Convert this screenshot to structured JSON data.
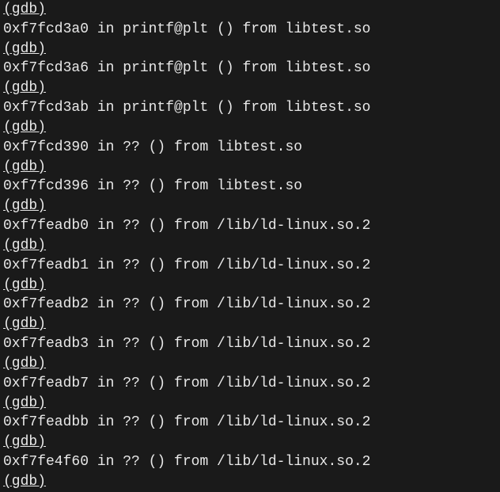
{
  "terminal": {
    "lines": [
      {
        "text": "(gdb)",
        "underline": true
      },
      {
        "text": "0xf7fcd3a0 in printf@plt () from libtest.so",
        "underline": false
      },
      {
        "text": "(gdb)",
        "underline": true
      },
      {
        "text": "0xf7fcd3a6 in printf@plt () from libtest.so",
        "underline": false
      },
      {
        "text": "(gdb)",
        "underline": true
      },
      {
        "text": "0xf7fcd3ab in printf@plt () from libtest.so",
        "underline": false
      },
      {
        "text": "(gdb)",
        "underline": true
      },
      {
        "text": "0xf7fcd390 in ?? () from libtest.so",
        "underline": false
      },
      {
        "text": "(gdb)",
        "underline": true
      },
      {
        "text": "0xf7fcd396 in ?? () from libtest.so",
        "underline": false
      },
      {
        "text": "(gdb)",
        "underline": true
      },
      {
        "text": "0xf7feadb0 in ?? () from /lib/ld-linux.so.2",
        "underline": false
      },
      {
        "text": "(gdb)",
        "underline": true
      },
      {
        "text": "0xf7feadb1 in ?? () from /lib/ld-linux.so.2",
        "underline": false
      },
      {
        "text": "(gdb)",
        "underline": true
      },
      {
        "text": "0xf7feadb2 in ?? () from /lib/ld-linux.so.2",
        "underline": false
      },
      {
        "text": "(gdb)",
        "underline": true
      },
      {
        "text": "0xf7feadb3 in ?? () from /lib/ld-linux.so.2",
        "underline": false
      },
      {
        "text": "(gdb)",
        "underline": true
      },
      {
        "text": "0xf7feadb7 in ?? () from /lib/ld-linux.so.2",
        "underline": false
      },
      {
        "text": "(gdb)",
        "underline": true
      },
      {
        "text": "0xf7feadbb in ?? () from /lib/ld-linux.so.2",
        "underline": false
      },
      {
        "text": "(gdb)",
        "underline": true
      },
      {
        "text": "0xf7fe4f60 in ?? () from /lib/ld-linux.so.2",
        "underline": false
      },
      {
        "text": "(gdb)",
        "underline": true
      }
    ]
  }
}
